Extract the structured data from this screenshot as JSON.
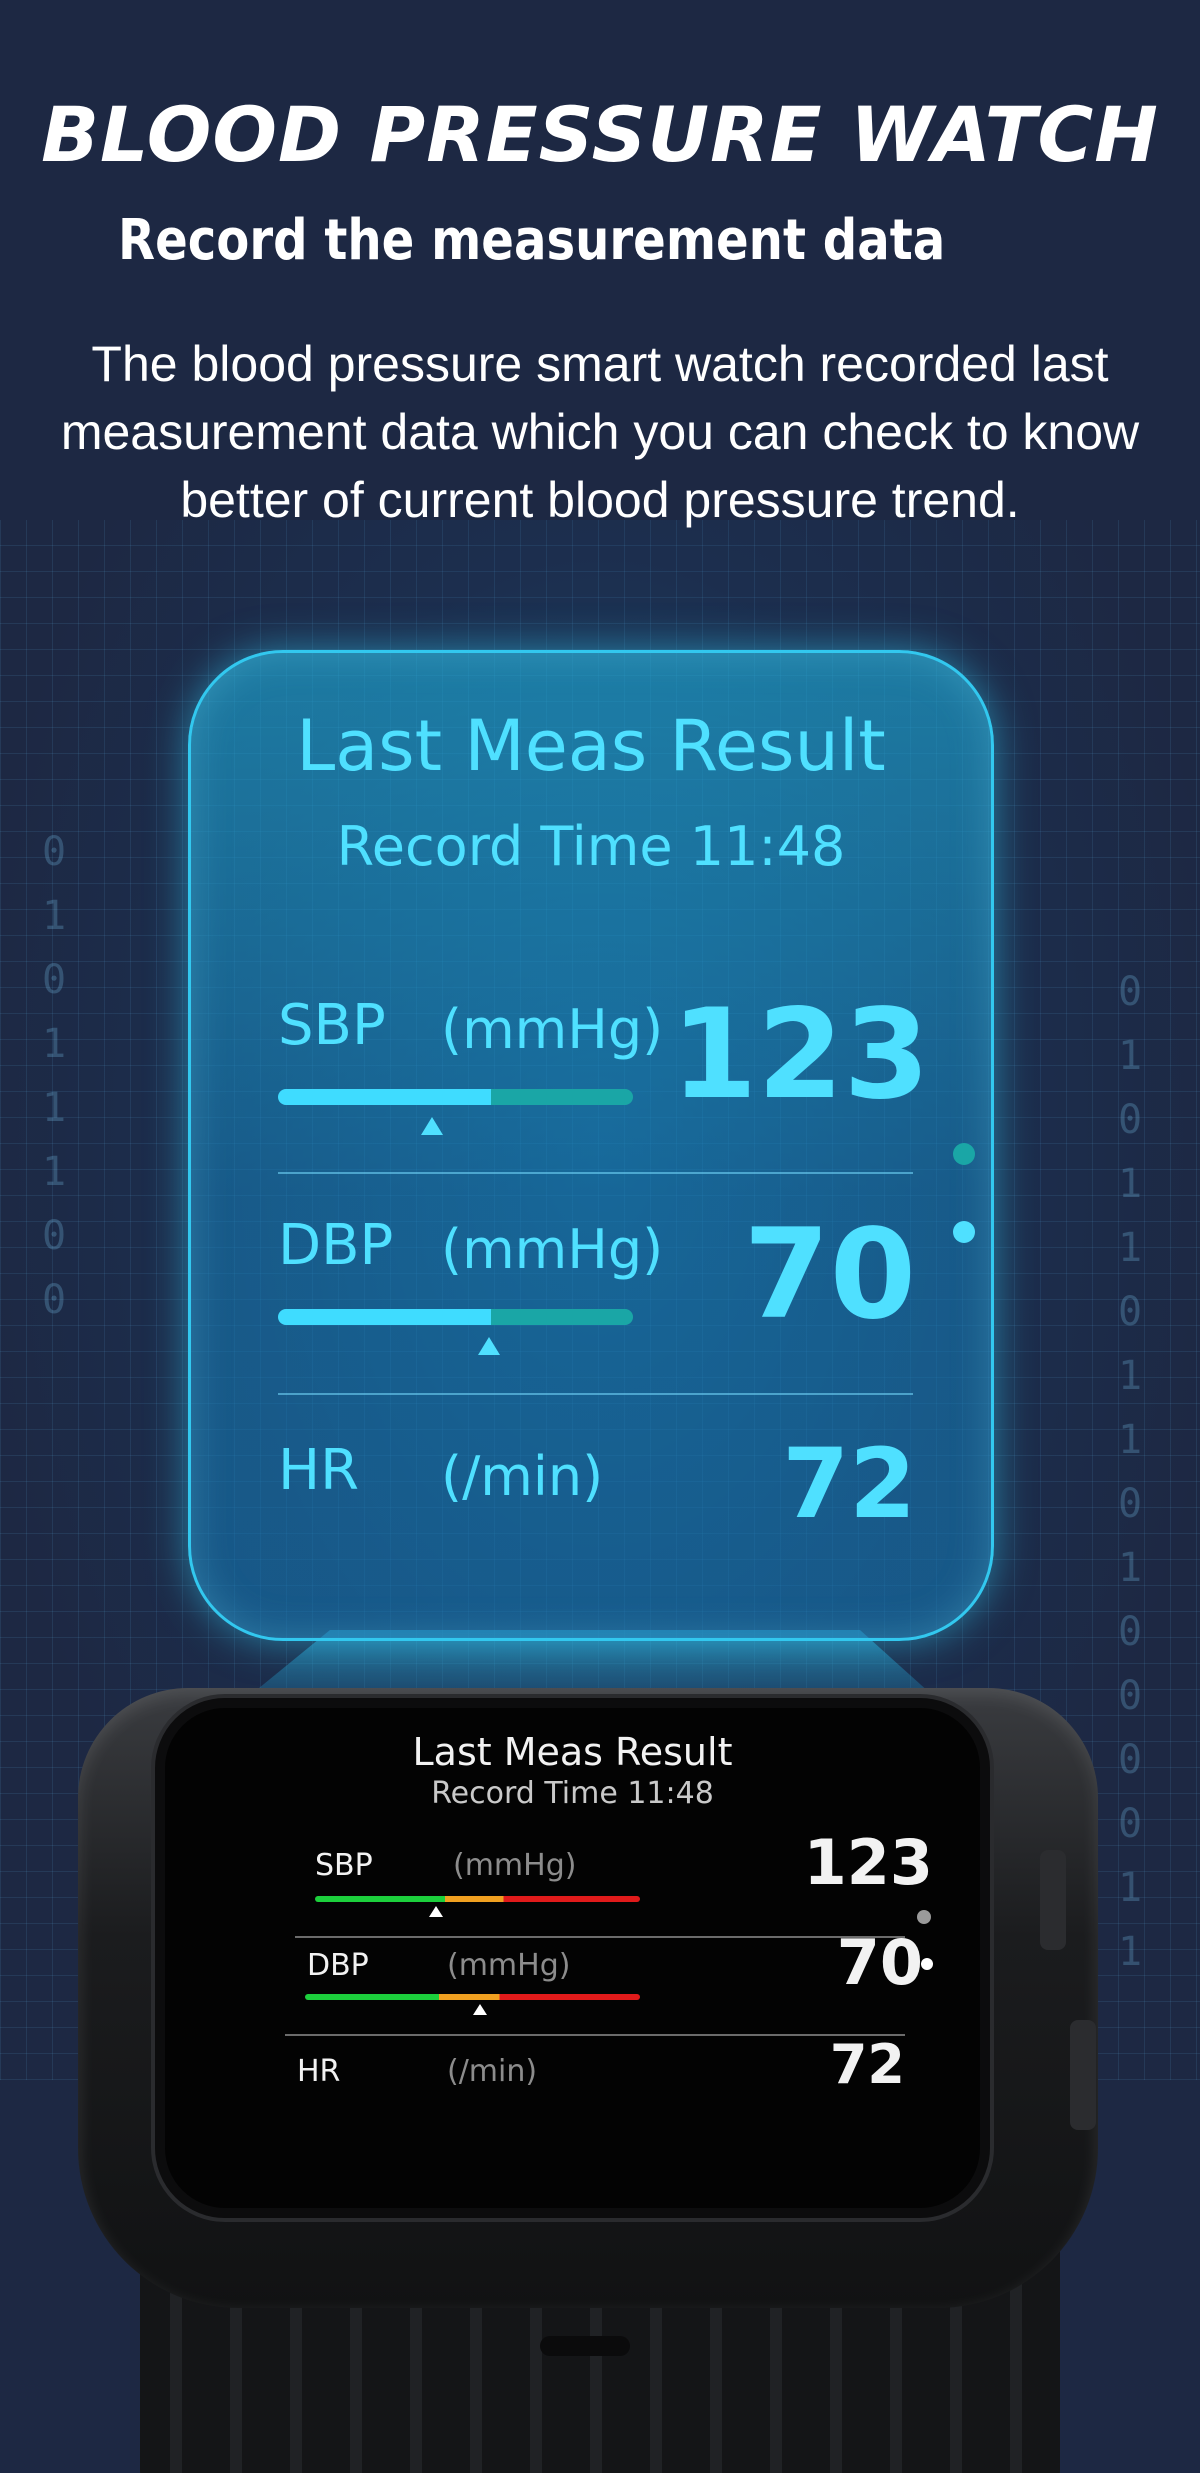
{
  "header": {
    "title": "BLOOD PRESSURE WATCH",
    "subtitle": "Record the measurement data",
    "description": "The blood pressure smart watch recorded last measurement data which you can check to know better of current blood pressure trend."
  },
  "projection": {
    "title": "Last Meas Result",
    "record_time": "Record Time  11:48",
    "rows": [
      {
        "label": "SBP",
        "unit": "(mmHg)",
        "value": "123"
      },
      {
        "label": "DBP",
        "unit": "(mmHg)",
        "value": "70"
      },
      {
        "label": "HR",
        "unit": "(/min)",
        "value": "72"
      }
    ]
  },
  "watch_screen": {
    "title": "Last Meas Result",
    "record_time": "Record Time   11:48",
    "rows": [
      {
        "label": "SBP",
        "unit": "(mmHg)",
        "value": "123"
      },
      {
        "label": "DBP",
        "unit": "(mmHg)",
        "value": "70"
      },
      {
        "label": "HR",
        "unit": "(/min)",
        "value": "72"
      }
    ]
  },
  "colors": {
    "background": "#1d2843",
    "holo_accent": "#4fe0ff",
    "gauge_green": "#1ccf3c",
    "gauge_orange": "#f0a020",
    "gauge_red": "#e01a1a"
  }
}
